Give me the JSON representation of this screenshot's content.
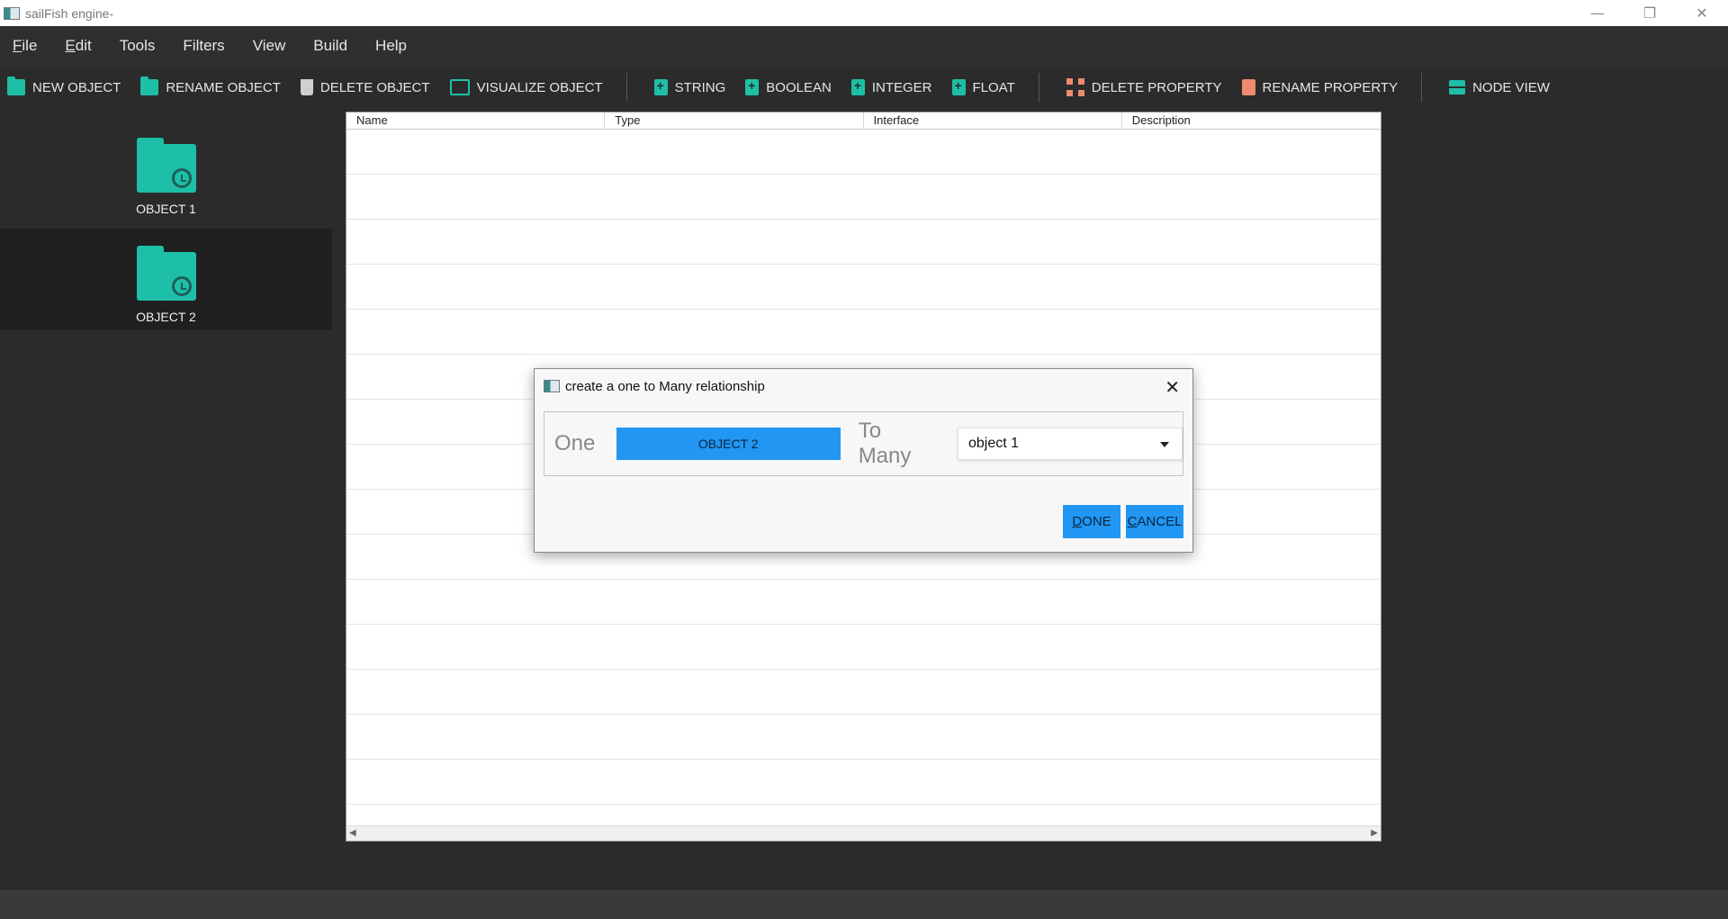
{
  "window": {
    "title": "sailFish engine-",
    "minimize": "—",
    "restore": "❐",
    "close": "✕"
  },
  "menu": [
    {
      "accel": "F",
      "rest": "ile"
    },
    {
      "accel": "E",
      "rest": "dit"
    },
    {
      "accel": "",
      "rest": "Tools"
    },
    {
      "accel": "",
      "rest": "Filters"
    },
    {
      "accel": "",
      "rest": "View"
    },
    {
      "accel": "",
      "rest": "Build"
    },
    {
      "accel": "",
      "rest": "Help"
    }
  ],
  "toolbar": {
    "new_object": "NEW OBJECT",
    "rename_object": "RENAME OBJECT",
    "delete_object": "DELETE OBJECT",
    "visualize_object": "VISUALIZE OBJECT",
    "string": "STRING",
    "boolean": "BOOLEAN",
    "integer": "INTEGER",
    "float": "FLOAT",
    "delete_property": "DELETE PROPERTY",
    "rename_property": "RENAME PROPERTY",
    "node_view": "NODE VIEW"
  },
  "objects": [
    {
      "label": "OBJECT 1"
    },
    {
      "label": "OBJECT 2"
    }
  ],
  "table": {
    "columns": [
      "Name",
      "Type",
      "Interface",
      "Description"
    ]
  },
  "dialog": {
    "title": "create a one to Many relationship",
    "close": "✕",
    "one_label": "One",
    "one_value": "OBJECT 2",
    "many_label": "To Many",
    "many_value": "object 1",
    "done_accel": "D",
    "done_rest": "ONE",
    "cancel_accel": "C",
    "cancel_rest": "ANCEL"
  },
  "scroll": {
    "left": "◀",
    "right": "▶"
  }
}
